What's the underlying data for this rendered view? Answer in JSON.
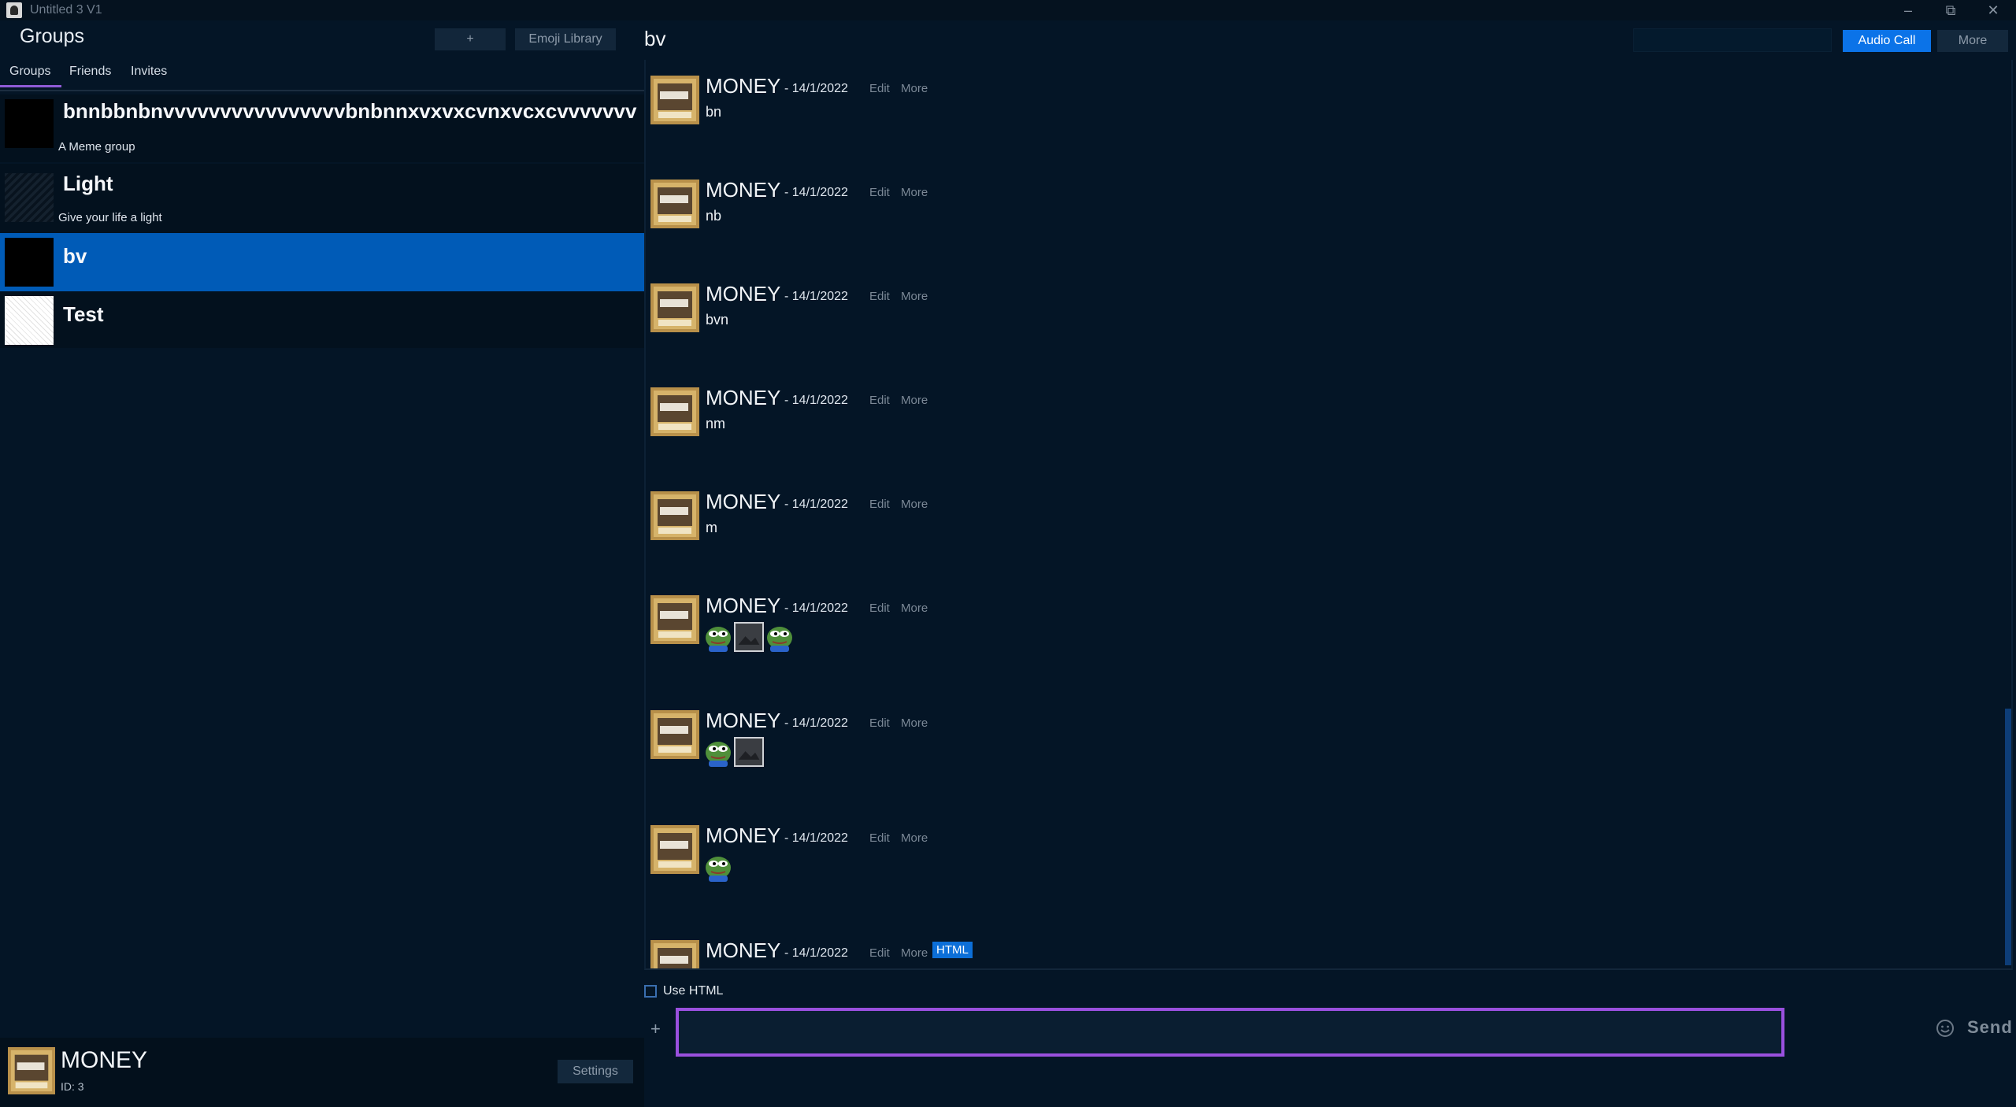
{
  "window": {
    "title": "Untitled 3 V1",
    "minimize_icon": "minimize-icon",
    "maximize_icon": "restore-icon",
    "close_icon": "close-icon"
  },
  "sidebar": {
    "title": "Groups",
    "add_button": "+",
    "emoji_library_button": "Emoji Library",
    "tabs": [
      {
        "label": "Groups",
        "active": true
      },
      {
        "label": "Friends",
        "active": false
      },
      {
        "label": "Invites",
        "active": false
      }
    ],
    "groups": [
      {
        "name": "bnnbbnbnvvvvvvvvvvvvvvvvbnbnnxvxvxcvnxvcxcvvvvvvv",
        "description": "A Meme group",
        "thumb": "black"
      },
      {
        "name": "Light",
        "description": "Give your life a light",
        "thumb": "texture"
      },
      {
        "name": "bv",
        "description": "",
        "thumb": "black",
        "selected": true
      },
      {
        "name": "Test",
        "description": "",
        "thumb": "sketch"
      }
    ],
    "user": {
      "name": "MONEY",
      "id_label": "ID: 3",
      "settings_button": "Settings"
    }
  },
  "chat": {
    "title": "bv",
    "search": {
      "placeholder": "",
      "value": ""
    },
    "audio_call_button": "Audio Call",
    "more_button": "More",
    "messages": [
      {
        "author": "MONEY",
        "date": "- 14/1/2022",
        "edit": "Edit",
        "more": "More",
        "text": "bn"
      },
      {
        "author": "MONEY",
        "date": "- 14/1/2022",
        "edit": "Edit",
        "more": "More",
        "text": "nb"
      },
      {
        "author": "MONEY",
        "date": "- 14/1/2022",
        "edit": "Edit",
        "more": "More",
        "text": "bvn"
      },
      {
        "author": "MONEY",
        "date": "- 14/1/2022",
        "edit": "Edit",
        "more": "More",
        "text": "nm"
      },
      {
        "author": "MONEY",
        "date": "- 14/1/2022",
        "edit": "Edit",
        "more": "More",
        "text": "m"
      },
      {
        "author": "MONEY",
        "date": "- 14/1/2022",
        "edit": "Edit",
        "more": "More",
        "emojis": [
          "pepe-emoji",
          "image-placeholder-icon",
          "pepe-emoji"
        ]
      },
      {
        "author": "MONEY",
        "date": "- 14/1/2022",
        "edit": "Edit",
        "more": "More",
        "emojis": [
          "pepe-emoji",
          "image-placeholder-icon"
        ]
      },
      {
        "author": "MONEY",
        "date": "- 14/1/2022",
        "edit": "Edit",
        "more": "More",
        "emojis": [
          "pepe-emoji"
        ]
      },
      {
        "author": "MONEY",
        "date": "- 14/1/2022",
        "edit": "Edit",
        "more": "More",
        "badge": "HTML"
      }
    ],
    "use_html_label": "Use HTML",
    "use_html_checked": false,
    "composer": {
      "placeholder": "",
      "value": ""
    },
    "attach_button": "+",
    "emoji_icon": "smiley-icon",
    "send_button": "Send"
  },
  "colors": {
    "background": "#041526",
    "selected_row": "#005bb7",
    "accent_purple": "#9a50de",
    "primary_button": "#0b73e8"
  }
}
